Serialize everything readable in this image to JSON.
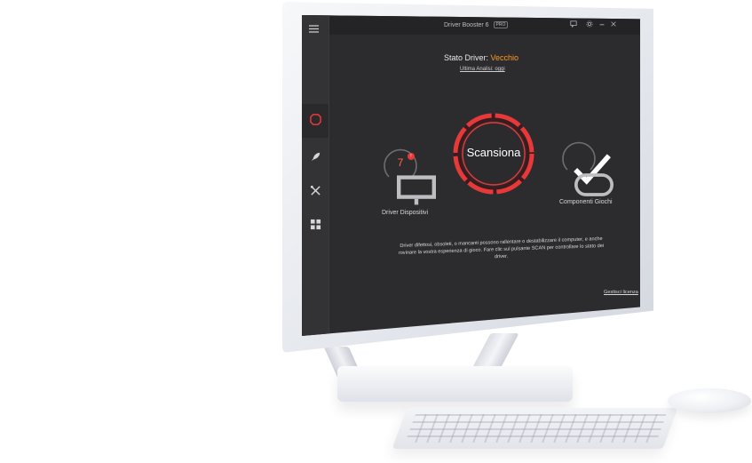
{
  "app": {
    "title": "Driver Booster 6",
    "edition_badge": "PRO"
  },
  "status": {
    "label": "Stato Driver:",
    "value": "Vecchio",
    "value_color": "#ff9a1f",
    "last_scan": "Ultima Analisi: oggi"
  },
  "sidebar": {
    "items": [
      {
        "icon": "shield-icon",
        "active": true
      },
      {
        "icon": "rocket-icon",
        "active": false
      },
      {
        "icon": "tools-icon",
        "active": false
      },
      {
        "icon": "grid-icon",
        "active": false
      }
    ]
  },
  "gauges": {
    "devices": {
      "count": "7",
      "badge": "!",
      "label": "Driver Dispositivi",
      "icon": "monitor-icon"
    },
    "games": {
      "label": "Componenti Giochi",
      "icon": "gamepad-icon",
      "check_icon": "check-icon"
    }
  },
  "scan": {
    "label": "Scansiona",
    "accent": "#e63a3a"
  },
  "description": "Driver difettosi, obsoleti, o mancanti possono rallentare o destabilizzare il computer, e anche rovinare la vostra esperienza di gioco. Fare clic sul pulsante SCAN per controllare lo stato dei driver.",
  "footer": {
    "license_link": "Gestisci licenza"
  }
}
